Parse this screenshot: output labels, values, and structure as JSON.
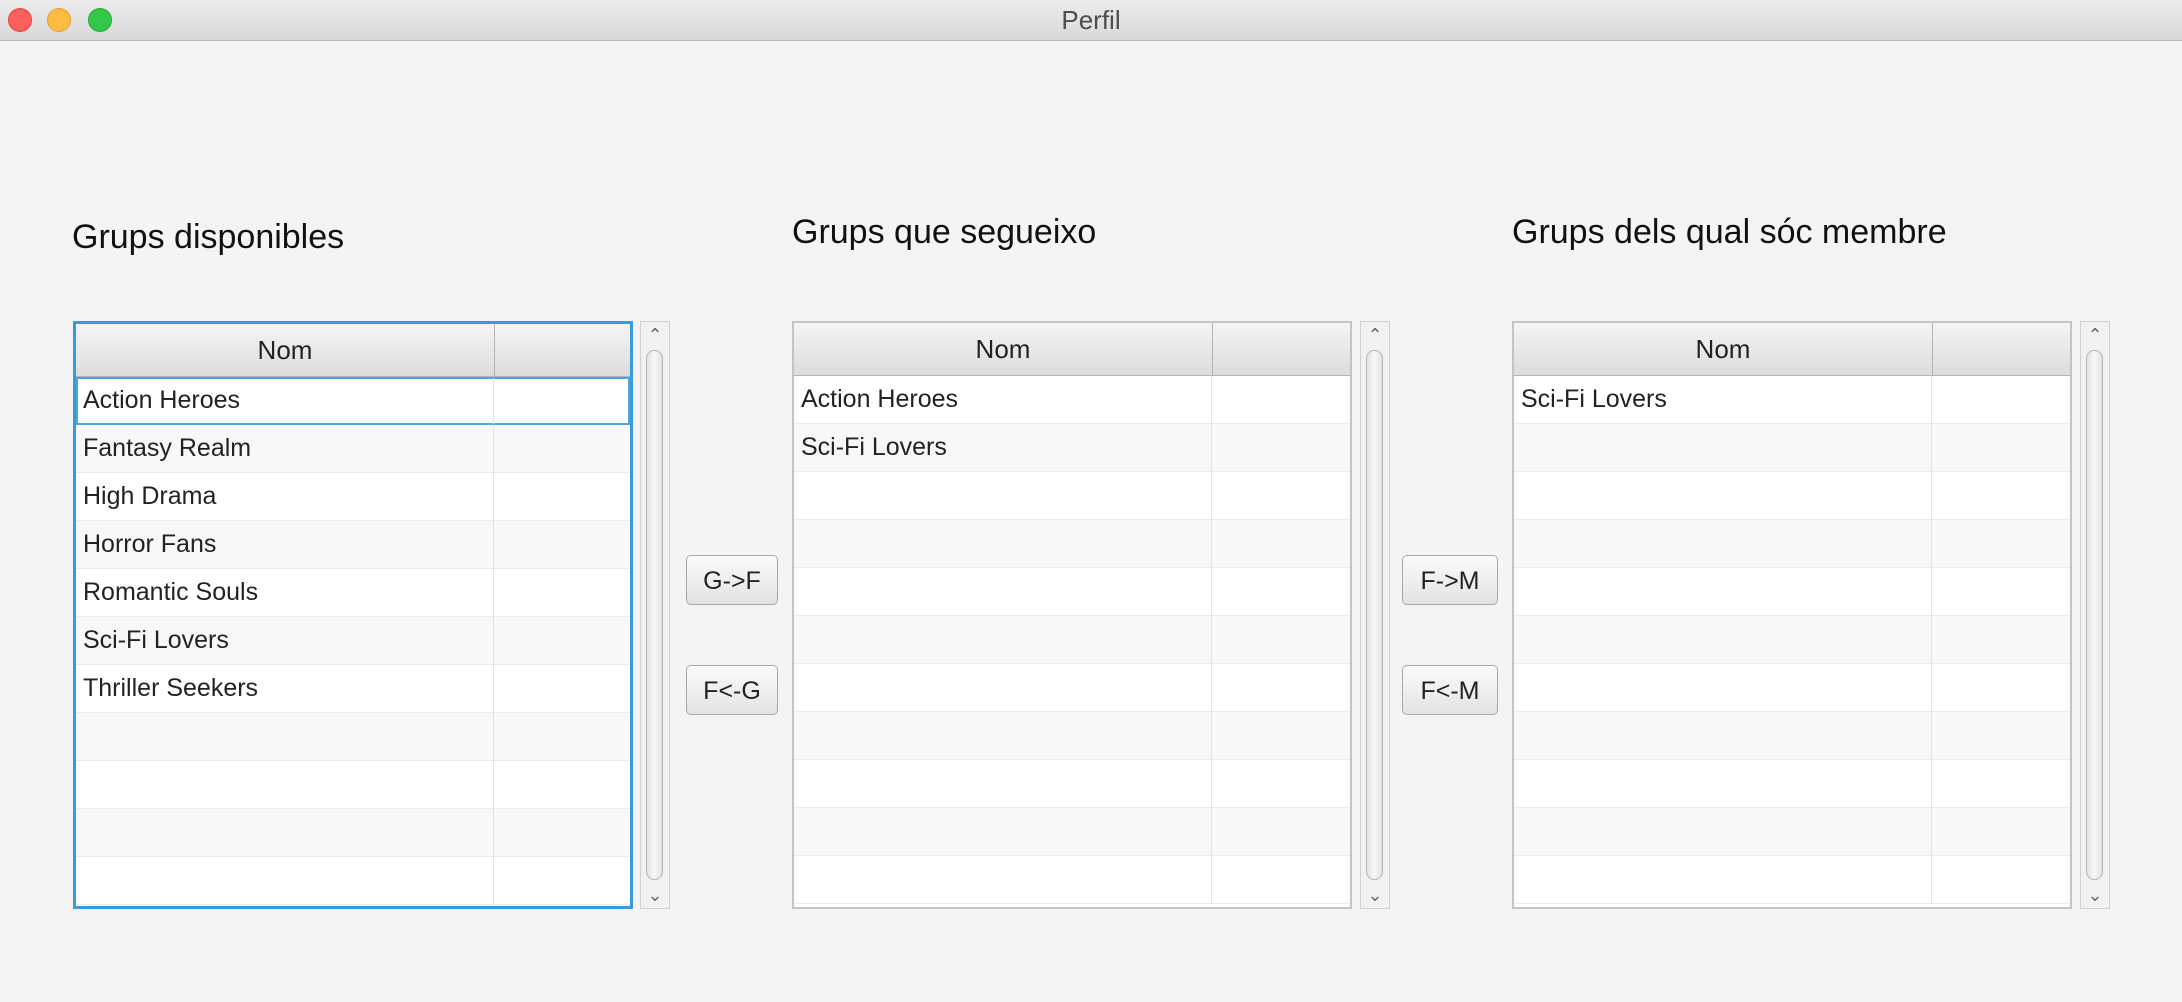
{
  "window": {
    "title": "Perfil"
  },
  "sections": {
    "available": {
      "heading": "Grups disponibles"
    },
    "following": {
      "heading": "Grups que segueixo"
    },
    "member": {
      "heading": "Grups dels qual sóc membre"
    }
  },
  "tables": {
    "available": {
      "column": "Nom",
      "rows": [
        "Action Heroes",
        "Fantasy Realm",
        "High Drama",
        "Horror Fans",
        "Romantic Souls",
        "Sci-Fi Lovers",
        "Thriller Seekers",
        "",
        "",
        "",
        ""
      ],
      "selected": "Action Heroes"
    },
    "following": {
      "column": "Nom",
      "rows": [
        "Action Heroes",
        "Sci-Fi Lovers",
        "",
        "",
        "",
        "",
        "",
        "",
        "",
        "",
        ""
      ]
    },
    "member": {
      "column": "Nom",
      "rows": [
        "Sci-Fi Lovers",
        "",
        "",
        "",
        "",
        "",
        "",
        "",
        "",
        "",
        ""
      ]
    }
  },
  "buttons": {
    "g_to_f": "G->F",
    "f_from_g": "F<-G",
    "f_to_m": "F->M",
    "f_from_m": "F<-M"
  },
  "icons": {
    "scroll_up": "chevron-up-icon",
    "scroll_down": "chevron-down-icon"
  }
}
